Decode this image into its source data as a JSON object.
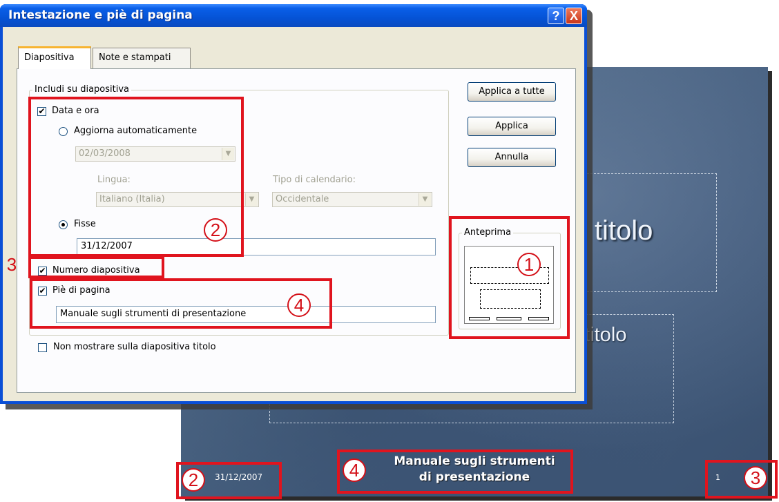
{
  "dialog": {
    "title": "Intestazione e piè di pagina",
    "help_button": "?",
    "close_button": "X",
    "tabs": [
      {
        "label": "Diapositiva",
        "active": true
      },
      {
        "label": "Note e stampati",
        "active": false
      }
    ],
    "include_group": {
      "legend": "Includi su diapositiva",
      "date_time": {
        "label": "Data e ora",
        "checked": true
      },
      "auto_update": {
        "label": "Aggiorna automaticamente",
        "selected": false,
        "value": "02/03/2008"
      },
      "language": {
        "label": "Lingua:",
        "value": "Italiano (Italia)"
      },
      "calendar": {
        "label": "Tipo di calendario:",
        "value": "Occidentale"
      },
      "fixed": {
        "label": "Fisse",
        "selected": true,
        "value": "31/12/2007"
      },
      "slide_number": {
        "label": "Numero diapositiva",
        "checked": true
      },
      "footer": {
        "label": "Piè di pagina",
        "checked": true,
        "value": "Manuale sugli strumenti di presentazione"
      }
    },
    "hide_on_title": {
      "label": "Non mostrare sulla diapositiva titolo",
      "checked": false
    },
    "buttons": {
      "apply_all": "Applica a tutte",
      "apply": "Applica",
      "cancel": "Annulla"
    },
    "preview": {
      "legend": "Anteprima"
    }
  },
  "slide": {
    "title_text": "il titolo",
    "subtitle_text": "otitolo",
    "date": "31/12/2007",
    "footer_line1": "Manuale sugli strumenti",
    "footer_line2": "di presentazione",
    "number": "1"
  },
  "callouts": {
    "one": "1",
    "two": "2",
    "three": "3",
    "four": "4"
  },
  "colors": {
    "callout": "#e0141e",
    "titlebar": "#0553d6",
    "slide_bg": "#4b6584"
  }
}
